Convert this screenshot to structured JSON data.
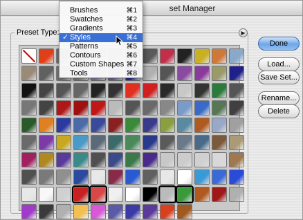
{
  "window": {
    "title": "Preset Manager",
    "title_visible": "set Manager"
  },
  "preset_type": {
    "label": "Preset Type:"
  },
  "buttons": {
    "done": "Done",
    "load": "Load...",
    "save_set": "Save Set...",
    "rename": "Rename...",
    "delete": "Delete"
  },
  "menu": {
    "items": [
      {
        "label": "Brushes",
        "shortcut": "⌘1"
      },
      {
        "label": "Swatches",
        "shortcut": "⌘2"
      },
      {
        "label": "Gradients",
        "shortcut": "⌘3"
      },
      {
        "label": "Styles",
        "shortcut": "⌘4",
        "checked": "✓"
      },
      {
        "label": "Patterns",
        "shortcut": "⌘5"
      },
      {
        "label": "Contours",
        "shortcut": "⌘6"
      },
      {
        "label": "Custom Shapes",
        "shortcut": "⌘7"
      },
      {
        "label": "Tools",
        "shortcut": "⌘8"
      }
    ]
  },
  "styles_grid": {
    "rows": [
      [
        "none",
        "#e04018",
        "#6a6a6a",
        "#3a3a3a",
        "#999999",
        "#888888",
        "#4a4a4a",
        "#5a5a5a",
        "#c0304a",
        "#222222",
        "#c8b020",
        "#d07838",
        "#8aa8c8"
      ],
      [
        "#9a8a78",
        "#606060",
        "#707070",
        "#888888",
        "#8888aa",
        "#7070a0",
        "#2a2aa0",
        "#b0b0b0",
        "#555555",
        "#8a4aa0",
        "#8a3a9a",
        "#9a9a6a",
        "#20208a"
      ],
      [
        "#111111",
        "#444444",
        "#555555",
        "#666666",
        "#222222",
        "#333333",
        "#e03020",
        "#d02020",
        "#2a2a2a",
        "#c8c8c8",
        "#333333",
        "#2a7a3a",
        "#555555"
      ],
      [
        "#777777",
        "#444444",
        "#b01818",
        "#a01010",
        "#c01818",
        "#bbbbbb",
        "#555555",
        "#6a6a6a",
        "#888888",
        "#7a9ac8",
        "#3a6ac8",
        "#557755",
        "#404040"
      ],
      [
        "#2a5a2a",
        "#e08020",
        "#2a3aa0",
        "#4a6aa8",
        "#3a4a9a",
        "#8a2020",
        "#3a8a3a",
        "#3a3a8a",
        "#8aa040",
        "#5a8aa0",
        "#b05a20",
        "#9aa8c8",
        "#a0a0a0"
      ],
      [
        "#6a6a6a",
        "#7a3aa8",
        "#c8a820",
        "#4a9ac8",
        "#5a6a7a",
        "#3a6a6a",
        "#4a8a5a",
        "#2a3a8a",
        "#5a5a5a",
        "#6a7a8a",
        "#4a6a8a",
        "#7a5a3a",
        "#aa9a78"
      ],
      [
        "#a02060",
        "#b08820",
        "#5a3a9a",
        "#3a8a8a",
        "#505050",
        "#3a4a8a",
        "#3a7a4a",
        "#4a2a8a",
        "#c8c8c8",
        "#cccccc",
        "#d0d0d0",
        "#d8d8d8",
        "#a07850"
      ],
      [
        "#505050",
        "#7a7a7a",
        "#909090",
        "#2a4aa0",
        "#e8e8e8",
        "#8a2a4a",
        "#2a5ad0",
        "#606060",
        "#e8e8e8",
        "#ffffff",
        "#3a9ad8",
        "#3a6ad8",
        "#2a4ad8"
      ],
      [
        "#e8e8e8",
        "#f8f8f8",
        "#d0d0d0",
        "#c82020",
        "#d84848",
        "#f0f0f0",
        "#ffffff",
        "#000000",
        "#bbbbbb",
        "#3a9a3a",
        "#b05a20",
        "#a01818",
        "#b0b0b0"
      ],
      [
        "#a03ac8",
        "#3a3a3a",
        "#b0b0b0",
        "#f0c050",
        "#d858d8",
        "#5a5aa8",
        "#3a3aa8",
        "#5a3a9a",
        "#d84020",
        "#a05a20",
        "",
        "",
        ""
      ]
    ],
    "selected_indices": [
      3,
      4,
      8,
      9
    ]
  }
}
